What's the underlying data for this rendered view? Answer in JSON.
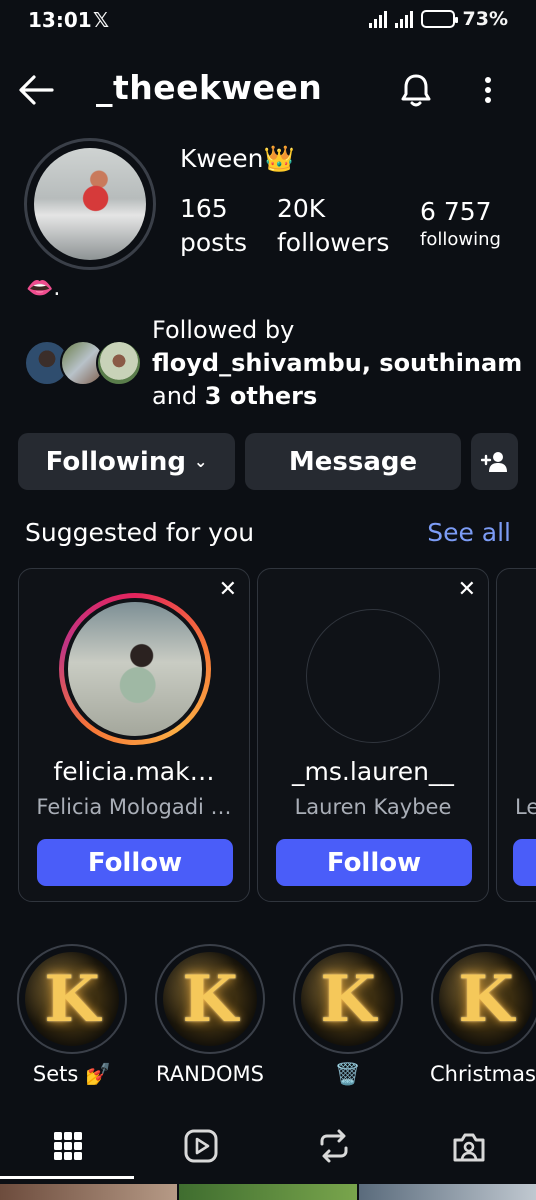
{
  "status_bar": {
    "time": "13:01",
    "battery": "73%",
    "battery_level": 0.73
  },
  "header": {
    "username": "_theekween"
  },
  "profile": {
    "display_name": "Kween👑",
    "posts_count": "165",
    "posts_label": "posts",
    "followers_count": "20K",
    "followers_label": "followers",
    "following_count": "6 757",
    "following_label": "following",
    "bio": "👄."
  },
  "mutual": {
    "prefix": "Followed by",
    "names": "floyd_shivambu, southinam",
    "and": "and",
    "others": "3 others"
  },
  "actions": {
    "following": "Following",
    "message": "Message"
  },
  "suggested": {
    "title": "Suggested for you",
    "see_all": "See all",
    "cards": [
      {
        "username": "felicia.mak…",
        "full_name": "Felicia Mologadi …",
        "follow": "Follow"
      },
      {
        "username": "_ms.lauren__",
        "full_name": "Lauren Kaybee",
        "follow": "Follow"
      },
      {
        "username": "",
        "full_name": "Le",
        "follow": ""
      }
    ]
  },
  "highlights": [
    {
      "label": "Sets 💅"
    },
    {
      "label": "RANDOMS"
    },
    {
      "label": "🗑️"
    },
    {
      "label": "Christmas."
    }
  ],
  "tabs": [
    "grid-icon",
    "reels-icon",
    "reposts-icon",
    "tagged-icon"
  ],
  "colors": {
    "accent_blue": "#4a5df9",
    "link_blue": "#7c9cf5",
    "background": "#0c0f14",
    "button_bg": "#262a31"
  }
}
